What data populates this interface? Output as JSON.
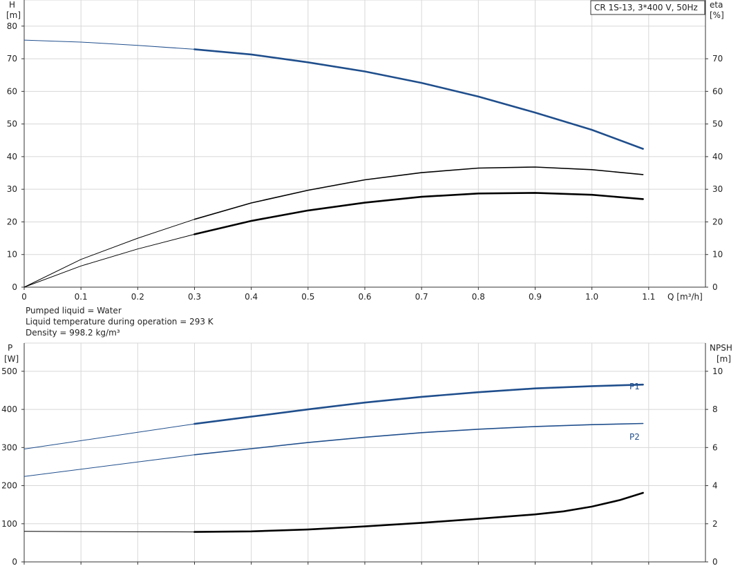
{
  "chart_data": [
    {
      "type": "line",
      "title_box": "CR 1S-13, 3*400 V, 50Hz",
      "left_axis": {
        "label_line1": "H",
        "label_line2": "[m]",
        "ylim": [
          0,
          88
        ],
        "ticks": [
          0,
          10,
          20,
          30,
          40,
          50,
          60,
          70,
          80
        ]
      },
      "right_axis": {
        "label_line1": "eta",
        "label_line2": "[%]",
        "ylim": [
          0,
          88
        ],
        "ticks": [
          0,
          10,
          20,
          30,
          40,
          50,
          60,
          70
        ]
      },
      "x_axis": {
        "label": "Q [m³/h]",
        "xlim": [
          0,
          1.2
        ],
        "ticks": [
          0,
          0.1,
          0.2,
          0.3,
          0.4,
          0.5,
          0.6,
          0.7,
          0.8,
          0.9,
          1.0,
          1.1
        ],
        "tick_labels": [
          "0",
          "0.1",
          "0.2",
          "0.3",
          "0.4",
          "0.5",
          "0.6",
          "0.7",
          "0.8",
          "0.9",
          "1.0",
          "1.1"
        ]
      },
      "grid": true,
      "operating_range_start": 0.3,
      "series": [
        {
          "key": "head",
          "axis": "left",
          "color": "#1f4e8c",
          "x": [
            0,
            0.1,
            0.2,
            0.3,
            0.4,
            0.5,
            0.6,
            0.7,
            0.8,
            0.9,
            1.0,
            1.09
          ],
          "y": [
            75.7,
            75.1,
            74.1,
            72.9,
            71.3,
            68.9,
            66.1,
            62.6,
            58.4,
            53.5,
            48.2,
            42.4
          ]
        },
        {
          "key": "eta_thin",
          "axis": "right",
          "color": "#000000",
          "x": [
            0,
            0.1,
            0.2,
            0.3,
            0.4,
            0.5,
            0.6,
            0.7,
            0.8,
            0.9,
            1.0,
            1.09
          ],
          "y": [
            0,
            8.5,
            15.0,
            20.8,
            25.8,
            29.7,
            32.9,
            35.1,
            36.5,
            36.8,
            36.0,
            34.5
          ]
        },
        {
          "key": "eta_thick",
          "axis": "right",
          "color": "#000000",
          "x": [
            0,
            0.1,
            0.2,
            0.3,
            0.4,
            0.5,
            0.6,
            0.7,
            0.8,
            0.9,
            1.0,
            1.09
          ],
          "y": [
            0,
            6.5,
            11.7,
            16.2,
            20.3,
            23.5,
            25.9,
            27.7,
            28.7,
            28.9,
            28.3,
            27.0
          ]
        }
      ]
    },
    {
      "type": "line",
      "left_axis": {
        "label_line1": "P",
        "label_line2": "[W]",
        "ylim": [
          0,
          574
        ],
        "ticks": [
          0,
          100,
          200,
          300,
          400,
          500
        ]
      },
      "right_axis": {
        "label_line1": "NPSH",
        "label_line2": "[m]",
        "ylim": [
          0,
          11.48
        ],
        "ticks": [
          0,
          2,
          4,
          6,
          8,
          10
        ]
      },
      "x_axis": {
        "xlim": [
          0,
          1.2
        ],
        "ticks": [
          0,
          0.1,
          0.2,
          0.3,
          0.4,
          0.5,
          0.6,
          0.7,
          0.8,
          0.9,
          1.0,
          1.1
        ]
      },
      "grid": true,
      "operating_range_start": 0.3,
      "series": [
        {
          "key": "p1",
          "name": "P1",
          "axis": "left",
          "color": "#1f4e8c",
          "x": [
            0,
            0.1,
            0.2,
            0.3,
            0.4,
            0.5,
            0.6,
            0.7,
            0.8,
            0.9,
            1.0,
            1.09
          ],
          "y": [
            296,
            318,
            340,
            362,
            381,
            400,
            418,
            433,
            445,
            455,
            461,
            465
          ]
        },
        {
          "key": "p2",
          "name": "P2",
          "axis": "left",
          "color": "#1f4e8c",
          "x": [
            0,
            0.1,
            0.2,
            0.3,
            0.4,
            0.5,
            0.6,
            0.7,
            0.8,
            0.9,
            1.0,
            1.09
          ],
          "y": [
            224,
            243,
            262,
            281,
            297,
            313,
            327,
            339,
            348,
            355,
            360,
            363
          ]
        },
        {
          "key": "npsh",
          "axis": "right",
          "color": "#000000",
          "x": [
            0,
            0.1,
            0.2,
            0.3,
            0.4,
            0.5,
            0.6,
            0.7,
            0.8,
            0.9,
            0.95,
            1.0,
            1.05,
            1.09
          ],
          "y": [
            1.6,
            1.59,
            1.58,
            1.57,
            1.6,
            1.7,
            1.86,
            2.05,
            2.26,
            2.49,
            2.65,
            2.9,
            3.25,
            3.62
          ]
        }
      ]
    }
  ],
  "info": {
    "line1": "Pumped liquid = Water",
    "line2": "Liquid temperature during operation = 293 K",
    "line3": "Density = 998.2 kg/m³"
  }
}
